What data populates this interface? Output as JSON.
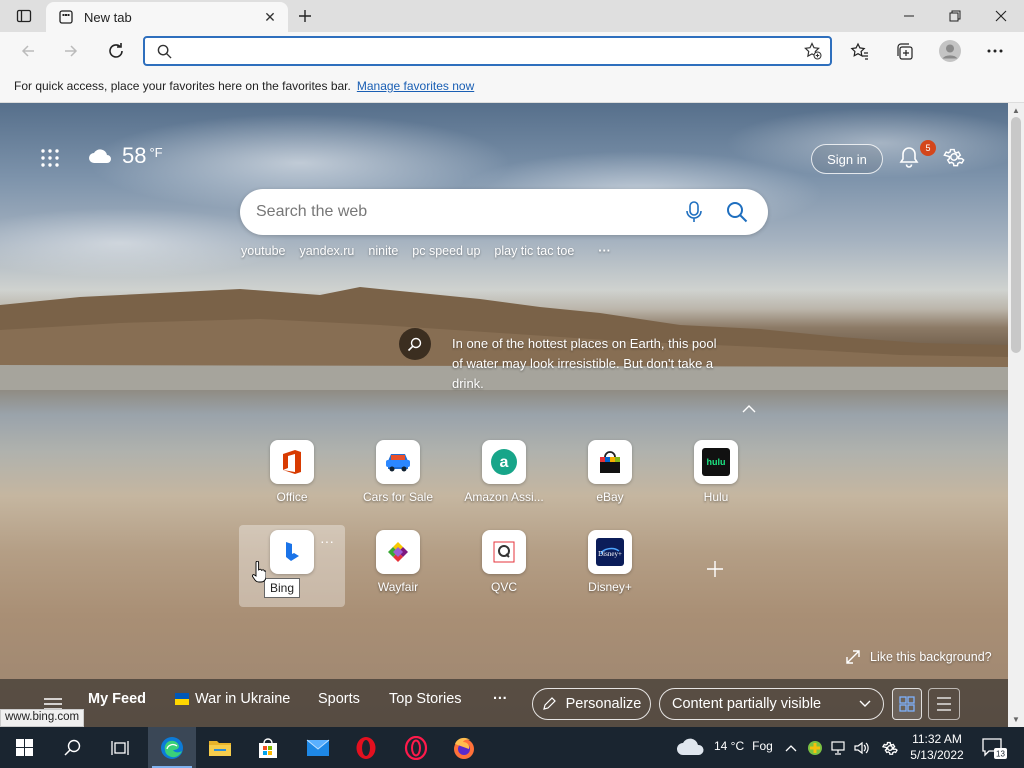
{
  "browser": {
    "tab_title": "New tab",
    "address_value": "",
    "favbar_text": "For quick access, place your favorites here on the favorites bar.",
    "favbar_link": "Manage favorites now"
  },
  "newtab": {
    "weather_temp": "58",
    "weather_unit": "°F",
    "sign_in": "Sign in",
    "notification_count": "5",
    "search_placeholder": "Search the web",
    "quick_links": [
      "youtube",
      "yandex.ru",
      "ninite",
      "pc speed up",
      "play tic tac toe"
    ],
    "more_dots": "···",
    "image_caption": "In one of the hottest places on Earth, this pool of water may look irresistible. But don't take a drink.",
    "tiles_row1": [
      "Office",
      "Cars for Sale",
      "Amazon Assi...",
      "eBay",
      "Hulu"
    ],
    "tiles_row2": [
      "Bing",
      "Wayfair",
      "QVC",
      "Disney+"
    ],
    "tooltip": "Bing",
    "like_background": "Like this background?",
    "feed": {
      "my_feed": "My Feed",
      "war": "War in Ukraine",
      "sports": "Sports",
      "top_stories": "Top Stories",
      "more": "···",
      "personalize": "Personalize",
      "content_visibility": "Content partially visible"
    },
    "status_url": "www.bing.com"
  },
  "taskbar": {
    "weather_temp": "14 °C",
    "weather_text": "Fog",
    "time": "11:32 AM",
    "date": "5/13/2022",
    "notification_count": "13"
  },
  "icons": [
    "tab-actions-icon",
    "new-tab-page-icon",
    "close-icon",
    "plus-icon",
    "minimize-icon",
    "restore-icon",
    "back-icon",
    "forward-icon",
    "refresh-icon",
    "search-icon",
    "add-favorite-icon",
    "favorites-icon",
    "collections-icon",
    "profile-icon",
    "more-icon",
    "apps-grid-icon",
    "cloud-icon",
    "bell-icon",
    "gear-icon",
    "microphone-icon",
    "visual-search-icon",
    "pencil-icon",
    "chevron-down-icon",
    "grid-view-icon",
    "list-view-icon",
    "windows-start-icon",
    "edge-icon",
    "file-explorer-icon",
    "store-icon",
    "mail-icon",
    "opera-icon",
    "firefox-icon"
  ]
}
